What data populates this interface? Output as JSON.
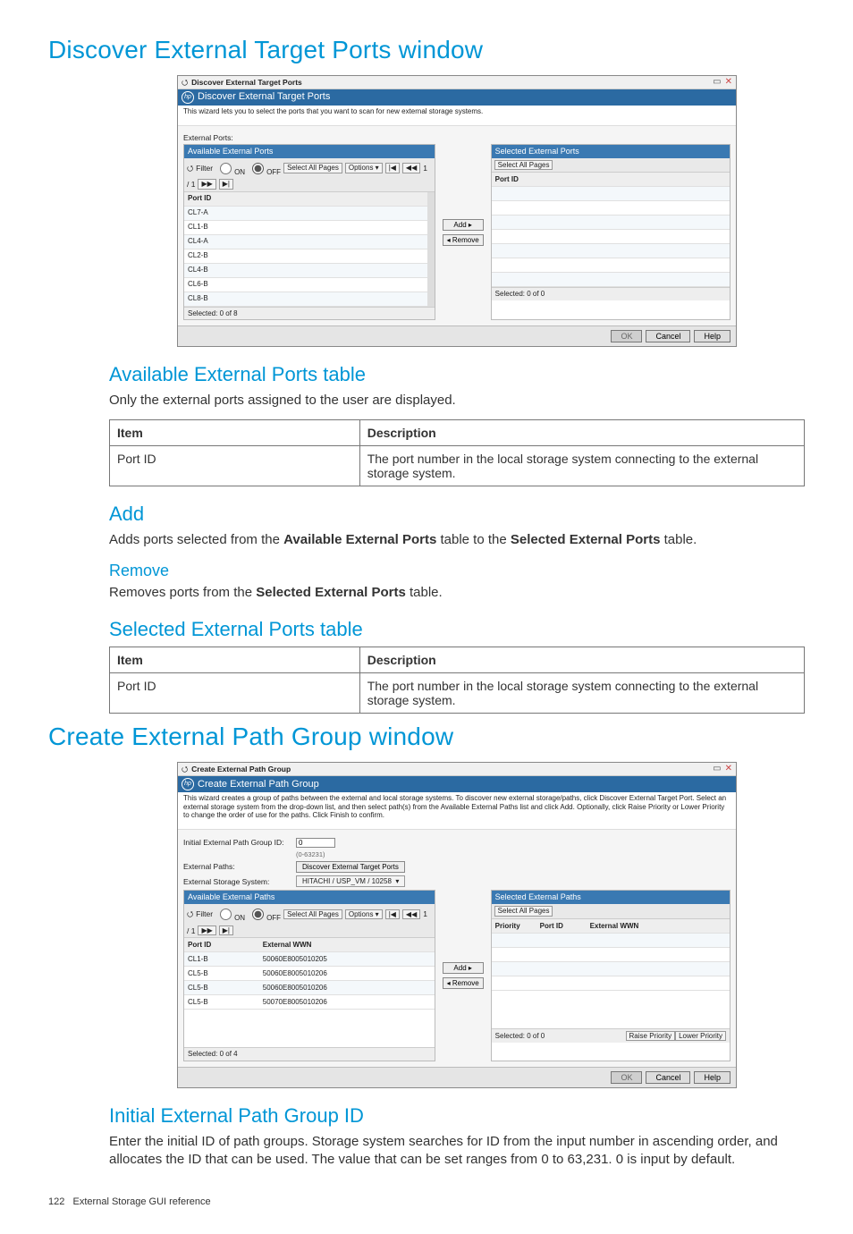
{
  "page": {
    "footer_pagenum": "122",
    "footer_section": "External Storage GUI reference"
  },
  "sec1": {
    "h1": "Discover External Target Ports window",
    "win": {
      "outer_title": "Discover External Target Ports",
      "inner_title": "Discover External Target Ports",
      "help": "This wizard lets you to select the ports that you want to scan for new external storage systems.",
      "ext_ports_label": "External Ports:",
      "avail_head": "Available External Ports",
      "sel_head": "Selected External Ports",
      "filter_label": "Filter",
      "on": "ON",
      "off": "OFF",
      "select_all": "Select All Pages",
      "options": "Options ▾",
      "nav_first": "|◀",
      "nav_prev": "◀◀",
      "page_cur": "1",
      "page_sep": "/ 1",
      "nav_next": "▶▶",
      "nav_last": "▶|",
      "col_portid": "Port ID",
      "rows": [
        "CL7-A",
        "CL1-B",
        "CL4-A",
        "CL2-B",
        "CL4-B",
        "CL6-B",
        "CL8-B"
      ],
      "add": "Add ▸",
      "remove": "◂ Remove",
      "selected_left": "Selected: 0  of  8",
      "selected_right": "Selected: 0  of  0",
      "ok": "OK",
      "cancel": "Cancel",
      "helpbtn": "Help"
    },
    "avail_h2": "Available External Ports table",
    "avail_p": "Only the external ports assigned to the user are displayed.",
    "tbl_item": "Item",
    "tbl_desc": "Description",
    "tbl_row_item": "Port ID",
    "tbl_row_desc": "The port number in the local storage system connecting to the external storage system.",
    "add_h2": "Add",
    "add_p_pre": "Adds ports selected from the ",
    "add_p_b1": "Available External Ports",
    "add_p_mid": " table to the ",
    "add_p_b2": "Selected External Ports",
    "add_p_post": " table.",
    "rem_h3": "Remove",
    "rem_p_pre": "Removes ports from the ",
    "rem_p_b1": "Selected External Ports",
    "rem_p_post": " table.",
    "sel_h2": "Selected External Ports table"
  },
  "sec2": {
    "h1": "Create External Path Group window",
    "win": {
      "outer_title": "Create External Path Group",
      "inner_title": "Create External Path Group",
      "help": "This wizard creates a group of paths between the external and local storage systems. To discover new external storage/paths, click Discover External Target Port. Select an external storage system from the drop-down list, and then select path(s) from the Available External Paths list and click Add. Optionally, click Raise Priority or Lower Priority to change the order of use for the paths. Click Finish to confirm.",
      "id_label": "Initial External Path Group ID:",
      "id_value": "0",
      "id_hint": "(0-63231)",
      "paths_label": "External Paths:",
      "discover_btn": "Discover External Target Ports",
      "ess_label": "External Storage System:",
      "ess_value": "HITACHI / USP_VM / 10258",
      "avail_head": "Available External Paths",
      "sel_head": "Selected External Paths",
      "col_portid": "Port ID",
      "col_extwwn": "External WWN",
      "col_priority": "Priority",
      "rows": [
        {
          "port": "CL1-B",
          "wwn": "50060E8005010205"
        },
        {
          "port": "CL5-B",
          "wwn": "50060E8005010206"
        },
        {
          "port": "CL5-B",
          "wwn": "50060E8005010206"
        },
        {
          "port": "CL5-B",
          "wwn": "50070E8005010206"
        }
      ],
      "filter_label": "Filter",
      "on": "ON",
      "off": "OFF",
      "select_all": "Select All Pages",
      "options": "Options ▾",
      "nav_first": "|◀",
      "nav_prev": "◀◀",
      "page_cur": "1",
      "page_sep": "/ 1",
      "nav_next": "▶▶",
      "nav_last": "▶|",
      "add": "Add ▸",
      "remove": "◂ Remove",
      "selected_left": "Selected: 0  of  4",
      "selected_right": "Selected: 0  of  0",
      "raise": "Raise Priority",
      "lower": "Lower Priority",
      "ok": "OK",
      "cancel": "Cancel",
      "helpbtn": "Help"
    },
    "id_h2": "Initial External Path Group ID",
    "id_p": "Enter the initial ID of path groups. Storage system searches for ID from the input number in ascending order, and allocates the ID that can be used. The value that can be set ranges from 0 to 63,231. 0 is input by default."
  }
}
